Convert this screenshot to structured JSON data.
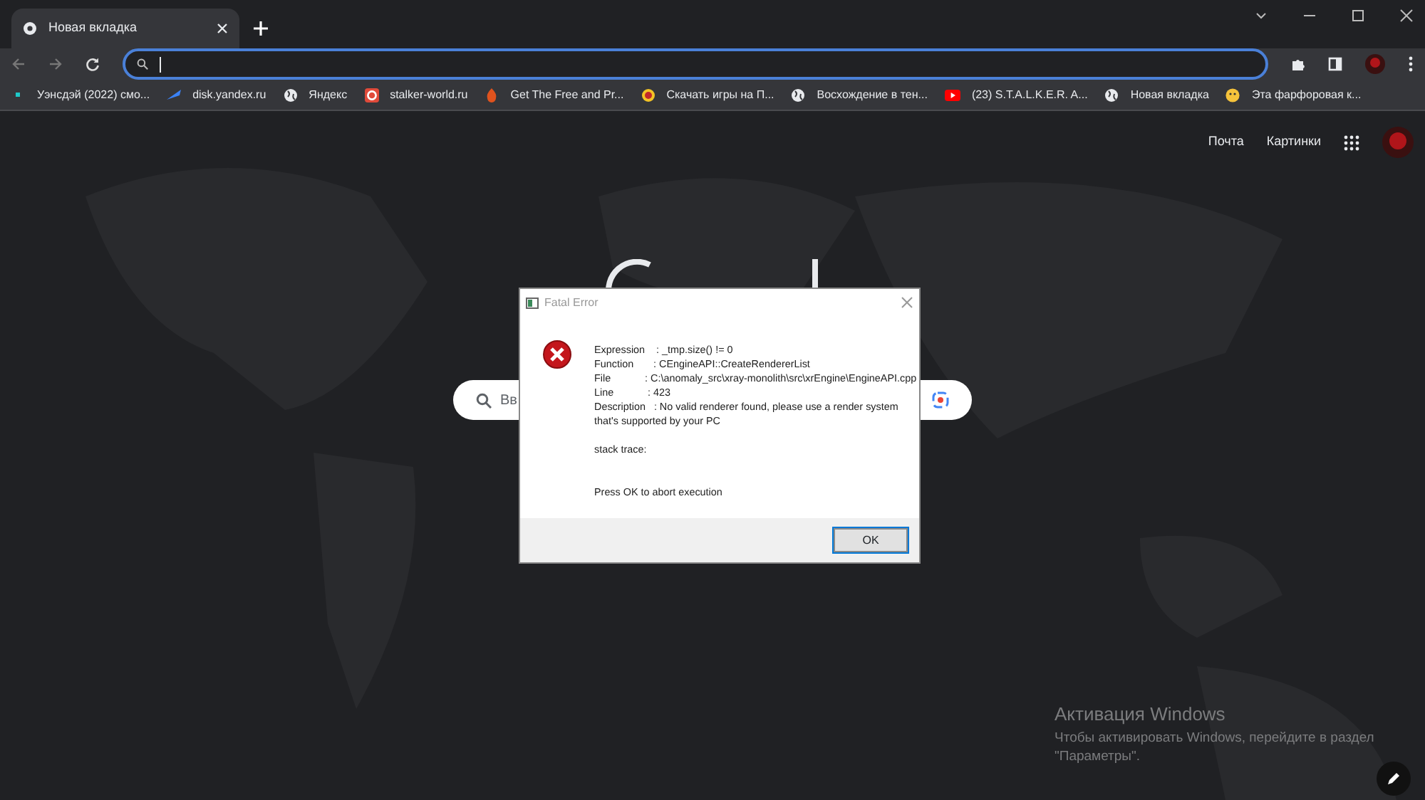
{
  "browser": {
    "tabs": [
      {
        "title": "Новая вкладка",
        "selected": true
      }
    ],
    "address": {
      "focused": true
    },
    "bookmarks": [
      {
        "label": "Уэнсдэй (2022) смо...",
        "kind": "dot"
      },
      {
        "label": "disk.yandex.ru",
        "kind": "disk"
      },
      {
        "label": "Яндекс",
        "kind": "globe"
      },
      {
        "label": "stalker-world.ru",
        "kind": "ring"
      },
      {
        "label": "Get The Free and Pr...",
        "kind": "flame"
      },
      {
        "label": "Скачать игры на П...",
        "kind": "emblem"
      },
      {
        "label": "Восхождение в тен...",
        "kind": "globe"
      },
      {
        "label": "(23) S.T.A.L.K.E.R. A...",
        "kind": "play"
      },
      {
        "label": "Новая вкладка",
        "kind": "globe"
      },
      {
        "label": "Эта фарфоровая к...",
        "kind": "smiley"
      }
    ]
  },
  "page": {
    "header_links": [
      "Почта",
      "Картинки"
    ],
    "search": {
      "placeholder": "Вв"
    }
  },
  "dialog": {
    "title": "Fatal Error",
    "lines": [
      "Expression    : _tmp.size() != 0",
      "Function       : CEngineAPI::CreateRendererList",
      "File            : C:\\anomaly_src\\xray-monolith\\src\\xrEngine\\EngineAPI.cpp",
      "Line            : 423",
      "Description   : No valid renderer found, please use a render system that's supported by your PC"
    ],
    "stack_label": "stack trace:",
    "prompt": "Press OK to abort execution",
    "button": "OK"
  },
  "activation": {
    "title": "Активация Windows",
    "text": "Чтобы активировать Windows, перейдите в раздел \"Параметры\"."
  }
}
